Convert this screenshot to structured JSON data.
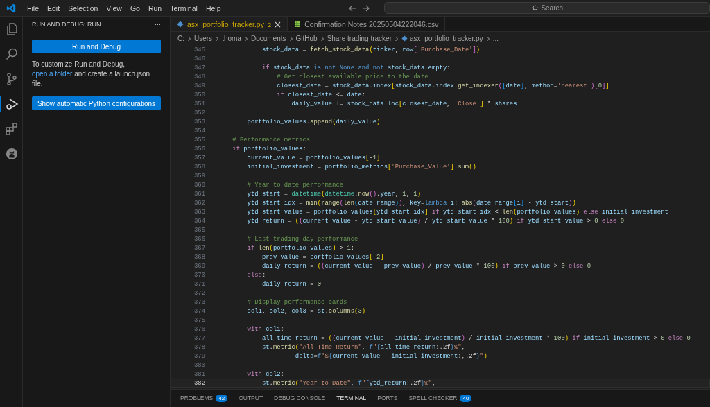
{
  "menu": [
    "File",
    "Edit",
    "Selection",
    "View",
    "Go",
    "Run",
    "Terminal",
    "Help"
  ],
  "search": {
    "placeholder": "Search"
  },
  "activity_bar": [
    {
      "kind": "files",
      "selected": false
    },
    {
      "kind": "search",
      "selected": false
    },
    {
      "kind": "source-control",
      "selected": false
    },
    {
      "kind": "run-debug",
      "selected": true
    },
    {
      "kind": "extensions",
      "selected": false
    },
    {
      "kind": "github",
      "selected": false
    }
  ],
  "sidebar": {
    "title": "RUN AND DEBUG: RUN",
    "more": "···",
    "run_button": "Run and Debug",
    "text_before": "To customize Run and Debug, ",
    "link": "open a folder",
    "text_after": " and create a launch.json file.",
    "python_button": "Show automatic Python configurations"
  },
  "tabs": [
    {
      "label": "asx_portfolio_tracker.py",
      "kind": "python",
      "badge": "2",
      "selected": true
    },
    {
      "label": "Confirmation Notes 20250504222046.csv",
      "kind": "csv",
      "selected": false
    }
  ],
  "breadcrumb": [
    "C:",
    "Users",
    "thoma",
    "Documents",
    "GitHub",
    "Share trading tracker",
    "asx_portfolio_tracker.py",
    "..."
  ],
  "code": [
    {
      "number": "345",
      "highlighted": false,
      "tokens": [
        {
          "kind": "var",
          "text": "            stock_data"
        },
        {
          "kind": "plain",
          "text": " = "
        },
        {
          "kind": "func",
          "text": "fetch_stock_data"
        },
        {
          "kind": "br1",
          "text": "("
        },
        {
          "kind": "var",
          "text": "ticker"
        },
        {
          "kind": "plain",
          "text": ", "
        },
        {
          "kind": "var",
          "text": "row"
        },
        {
          "kind": "br2",
          "text": "["
        },
        {
          "kind": "str",
          "text": "'Purchase_Date'"
        },
        {
          "kind": "br2",
          "text": "]"
        },
        {
          "kind": "br1",
          "text": ")"
        }
      ]
    },
    {
      "number": "346",
      "highlighted": false
    },
    {
      "number": "347",
      "highlighted": false,
      "tokens": [
        {
          "kind": "kw",
          "text": "            if "
        },
        {
          "kind": "var",
          "text": "stock_data "
        },
        {
          "kind": "ctl",
          "text": "is not None and not "
        },
        {
          "kind": "var",
          "text": "stock_data"
        },
        {
          "kind": "plain",
          "text": "."
        },
        {
          "kind": "var",
          "text": "empty"
        },
        {
          "kind": "plain",
          "text": ":"
        }
      ]
    },
    {
      "number": "348",
      "highlighted": false,
      "tokens": [
        {
          "kind": "com",
          "text": "                # Get closest available price to the date"
        }
      ]
    },
    {
      "number": "349",
      "highlighted": false,
      "tokens": [
        {
          "kind": "var",
          "text": "                closest_date"
        },
        {
          "kind": "plain",
          "text": " = "
        },
        {
          "kind": "var",
          "text": "stock_data"
        },
        {
          "kind": "plain",
          "text": "."
        },
        {
          "kind": "var",
          "text": "index"
        },
        {
          "kind": "br1",
          "text": "["
        },
        {
          "kind": "var",
          "text": "stock_data"
        },
        {
          "kind": "plain",
          "text": "."
        },
        {
          "kind": "var",
          "text": "index"
        },
        {
          "kind": "plain",
          "text": "."
        },
        {
          "kind": "func",
          "text": "get_indexer"
        },
        {
          "kind": "br2",
          "text": "("
        },
        {
          "kind": "br3",
          "text": "["
        },
        {
          "kind": "var",
          "text": "date"
        },
        {
          "kind": "br3",
          "text": "]"
        },
        {
          "kind": "plain",
          "text": ", "
        },
        {
          "kind": "var",
          "text": "method"
        },
        {
          "kind": "plain",
          "text": "="
        },
        {
          "kind": "str",
          "text": "'nearest'"
        },
        {
          "kind": "br2",
          "text": ")["
        },
        {
          "kind": "num",
          "text": "0"
        },
        {
          "kind": "br2",
          "text": "]"
        },
        {
          "kind": "br1",
          "text": "]"
        }
      ]
    },
    {
      "number": "350",
      "highlighted": false,
      "tokens": [
        {
          "kind": "kw",
          "text": "                if "
        },
        {
          "kind": "var",
          "text": "closest_date"
        },
        {
          "kind": "plain",
          "text": " <= "
        },
        {
          "kind": "var",
          "text": "date"
        },
        {
          "kind": "plain",
          "text": ":"
        }
      ]
    },
    {
      "number": "351",
      "highlighted": false,
      "tokens": [
        {
          "kind": "var",
          "text": "                    daily_value"
        },
        {
          "kind": "plain",
          "text": " += "
        },
        {
          "kind": "var",
          "text": "stock_data"
        },
        {
          "kind": "plain",
          "text": "."
        },
        {
          "kind": "var",
          "text": "loc"
        },
        {
          "kind": "br1",
          "text": "["
        },
        {
          "kind": "var",
          "text": "closest_date"
        },
        {
          "kind": "plain",
          "text": ", "
        },
        {
          "kind": "str",
          "text": "'Close'"
        },
        {
          "kind": "br1",
          "text": "]"
        },
        {
          "kind": "plain",
          "text": " * "
        },
        {
          "kind": "var",
          "text": "shares"
        }
      ]
    },
    {
      "number": "352",
      "highlighted": false
    },
    {
      "number": "353",
      "highlighted": false,
      "tokens": [
        {
          "kind": "var",
          "text": "        portfolio_values"
        },
        {
          "kind": "plain",
          "text": "."
        },
        {
          "kind": "func",
          "text": "append"
        },
        {
          "kind": "br1",
          "text": "("
        },
        {
          "kind": "var",
          "text": "daily_value"
        },
        {
          "kind": "br1",
          "text": ")"
        }
      ]
    },
    {
      "number": "354",
      "highlighted": false
    },
    {
      "number": "355",
      "highlighted": false,
      "tokens": [
        {
          "kind": "com",
          "text": "    # Performance metrics"
        }
      ]
    },
    {
      "number": "356",
      "highlighted": false,
      "tokens": [
        {
          "kind": "kw",
          "text": "    if "
        },
        {
          "kind": "var",
          "text": "portfolio_values"
        },
        {
          "kind": "plain",
          "text": ":"
        }
      ]
    },
    {
      "number": "357",
      "highlighted": false,
      "tokens": [
        {
          "kind": "var",
          "text": "        current_value"
        },
        {
          "kind": "plain",
          "text": " = "
        },
        {
          "kind": "var",
          "text": "portfolio_values"
        },
        {
          "kind": "br1",
          "text": "["
        },
        {
          "kind": "plain",
          "text": "-"
        },
        {
          "kind": "num",
          "text": "1"
        },
        {
          "kind": "br1",
          "text": "]"
        }
      ]
    },
    {
      "number": "358",
      "highlighted": false,
      "tokens": [
        {
          "kind": "var",
          "text": "        initial_investment"
        },
        {
          "kind": "plain",
          "text": " = "
        },
        {
          "kind": "var",
          "text": "portfolio_metrics"
        },
        {
          "kind": "br1",
          "text": "["
        },
        {
          "kind": "str",
          "text": "'Purchase_Value'"
        },
        {
          "kind": "br1",
          "text": "]"
        },
        {
          "kind": "plain",
          "text": "."
        },
        {
          "kind": "func",
          "text": "sum"
        },
        {
          "kind": "br1",
          "text": "()"
        }
      ]
    },
    {
      "number": "359",
      "highlighted": false
    },
    {
      "number": "360",
      "highlighted": false,
      "tokens": [
        {
          "kind": "com",
          "text": "        # Year to date performance"
        }
      ]
    },
    {
      "number": "361",
      "highlighted": false,
      "tokens": [
        {
          "kind": "var",
          "text": "        ytd_start"
        },
        {
          "kind": "plain",
          "text": " = "
        },
        {
          "kind": "type",
          "text": "datetime"
        },
        {
          "kind": "br1",
          "text": "("
        },
        {
          "kind": "type",
          "text": "datetime"
        },
        {
          "kind": "plain",
          "text": "."
        },
        {
          "kind": "func",
          "text": "now"
        },
        {
          "kind": "br2",
          "text": "()"
        },
        {
          "kind": "plain",
          "text": "."
        },
        {
          "kind": "var",
          "text": "year"
        },
        {
          "kind": "plain",
          "text": ", "
        },
        {
          "kind": "num",
          "text": "1"
        },
        {
          "kind": "plain",
          "text": ", "
        },
        {
          "kind": "num",
          "text": "1"
        },
        {
          "kind": "br1",
          "text": ")"
        }
      ]
    },
    {
      "number": "362",
      "highlighted": false,
      "tokens": [
        {
          "kind": "var",
          "text": "        ytd_start_idx"
        },
        {
          "kind": "plain",
          "text": " = "
        },
        {
          "kind": "func",
          "text": "min"
        },
        {
          "kind": "br1",
          "text": "("
        },
        {
          "kind": "func",
          "text": "range"
        },
        {
          "kind": "br2",
          "text": "("
        },
        {
          "kind": "func",
          "text": "len"
        },
        {
          "kind": "br3",
          "text": "("
        },
        {
          "kind": "var",
          "text": "date_range"
        },
        {
          "kind": "br3",
          "text": ")"
        },
        {
          "kind": "br2",
          "text": ")"
        },
        {
          "kind": "plain",
          "text": ", "
        },
        {
          "kind": "var",
          "text": "key"
        },
        {
          "kind": "plain",
          "text": "="
        },
        {
          "kind": "ctl",
          "text": "lambda "
        },
        {
          "kind": "var",
          "text": "i"
        },
        {
          "kind": "plain",
          "text": ": "
        },
        {
          "kind": "func",
          "text": "abs"
        },
        {
          "kind": "br2",
          "text": "("
        },
        {
          "kind": "var",
          "text": "date_range"
        },
        {
          "kind": "br3",
          "text": "["
        },
        {
          "kind": "var",
          "text": "i"
        },
        {
          "kind": "br3",
          "text": "]"
        },
        {
          "kind": "plain",
          "text": " - "
        },
        {
          "kind": "var",
          "text": "ytd_start"
        },
        {
          "kind": "br2",
          "text": ")"
        },
        {
          "kind": "br1",
          "text": ")"
        }
      ]
    },
    {
      "number": "363",
      "highlighted": false,
      "tokens": [
        {
          "kind": "var",
          "text": "        ytd_start_value"
        },
        {
          "kind": "plain",
          "text": " = "
        },
        {
          "kind": "var",
          "text": "portfolio_values"
        },
        {
          "kind": "br1",
          "text": "["
        },
        {
          "kind": "var",
          "text": "ytd_start_idx"
        },
        {
          "kind": "br1",
          "text": "]"
        },
        {
          "kind": "kw",
          "text": " if "
        },
        {
          "kind": "var",
          "text": "ytd_start_idx"
        },
        {
          "kind": "plain",
          "text": " < "
        },
        {
          "kind": "func",
          "text": "len"
        },
        {
          "kind": "br1",
          "text": "("
        },
        {
          "kind": "var",
          "text": "portfolio_values"
        },
        {
          "kind": "br1",
          "text": ")"
        },
        {
          "kind": "kw",
          "text": " else "
        },
        {
          "kind": "var",
          "text": "initial_investment"
        }
      ]
    },
    {
      "number": "364",
      "highlighted": false,
      "tokens": [
        {
          "kind": "var",
          "text": "        ytd_return"
        },
        {
          "kind": "plain",
          "text": " = "
        },
        {
          "kind": "br1",
          "text": "("
        },
        {
          "kind": "br2",
          "text": "("
        },
        {
          "kind": "var",
          "text": "current_value"
        },
        {
          "kind": "plain",
          "text": " - "
        },
        {
          "kind": "var",
          "text": "ytd_start_value"
        },
        {
          "kind": "br2",
          "text": ")"
        },
        {
          "kind": "plain",
          "text": " / "
        },
        {
          "kind": "var",
          "text": "ytd_start_value"
        },
        {
          "kind": "plain",
          "text": " * "
        },
        {
          "kind": "num",
          "text": "100"
        },
        {
          "kind": "br1",
          "text": ")"
        },
        {
          "kind": "kw",
          "text": " if "
        },
        {
          "kind": "var",
          "text": "ytd_start_value"
        },
        {
          "kind": "plain",
          "text": " > "
        },
        {
          "kind": "num",
          "text": "0"
        },
        {
          "kind": "kw",
          "text": " else "
        },
        {
          "kind": "num",
          "text": "0"
        }
      ]
    },
    {
      "number": "365",
      "highlighted": false
    },
    {
      "number": "366",
      "highlighted": false,
      "tokens": [
        {
          "kind": "com",
          "text": "        # Last trading day performance"
        }
      ]
    },
    {
      "number": "367",
      "highlighted": false,
      "tokens": [
        {
          "kind": "kw",
          "text": "        if "
        },
        {
          "kind": "func",
          "text": "len"
        },
        {
          "kind": "br1",
          "text": "("
        },
        {
          "kind": "var",
          "text": "portfolio_values"
        },
        {
          "kind": "br1",
          "text": ")"
        },
        {
          "kind": "plain",
          "text": " > "
        },
        {
          "kind": "num",
          "text": "1"
        },
        {
          "kind": "plain",
          "text": ":"
        }
      ]
    },
    {
      "number": "368",
      "highlighted": false,
      "tokens": [
        {
          "kind": "var",
          "text": "            prev_value"
        },
        {
          "kind": "plain",
          "text": " = "
        },
        {
          "kind": "var",
          "text": "portfolio_values"
        },
        {
          "kind": "br1",
          "text": "["
        },
        {
          "kind": "plain",
          "text": "-"
        },
        {
          "kind": "num",
          "text": "2"
        },
        {
          "kind": "br1",
          "text": "]"
        }
      ]
    },
    {
      "number": "369",
      "highlighted": false,
      "tokens": [
        {
          "kind": "var",
          "text": "            daily_return"
        },
        {
          "kind": "plain",
          "text": " = "
        },
        {
          "kind": "br1",
          "text": "("
        },
        {
          "kind": "br2",
          "text": "("
        },
        {
          "kind": "var",
          "text": "current_value"
        },
        {
          "kind": "plain",
          "text": " - "
        },
        {
          "kind": "var",
          "text": "prev_value"
        },
        {
          "kind": "br2",
          "text": ")"
        },
        {
          "kind": "plain",
          "text": " / "
        },
        {
          "kind": "var",
          "text": "prev_value"
        },
        {
          "kind": "plain",
          "text": " * "
        },
        {
          "kind": "num",
          "text": "100"
        },
        {
          "kind": "br1",
          "text": ")"
        },
        {
          "kind": "kw",
          "text": " if "
        },
        {
          "kind": "var",
          "text": "prev_value"
        },
        {
          "kind": "plain",
          "text": " > "
        },
        {
          "kind": "num",
          "text": "0"
        },
        {
          "kind": "kw",
          "text": " else "
        },
        {
          "kind": "num",
          "text": "0"
        }
      ]
    },
    {
      "number": "370",
      "highlighted": false,
      "tokens": [
        {
          "kind": "kw",
          "text": "        else"
        },
        {
          "kind": "plain",
          "text": ":"
        }
      ]
    },
    {
      "number": "371",
      "highlighted": false,
      "tokens": [
        {
          "kind": "var",
          "text": "            daily_return"
        },
        {
          "kind": "plain",
          "text": " = "
        },
        {
          "kind": "num",
          "text": "0"
        }
      ]
    },
    {
      "number": "372",
      "highlighted": false
    },
    {
      "number": "373",
      "highlighted": false,
      "tokens": [
        {
          "kind": "com",
          "text": "        # Display performance cards"
        }
      ]
    },
    {
      "number": "374",
      "highlighted": false,
      "tokens": [
        {
          "kind": "var",
          "text": "        col1"
        },
        {
          "kind": "plain",
          "text": ", "
        },
        {
          "kind": "var",
          "text": "col2"
        },
        {
          "kind": "plain",
          "text": ", "
        },
        {
          "kind": "var",
          "text": "col3"
        },
        {
          "kind": "plain",
          "text": " = "
        },
        {
          "kind": "var",
          "text": "st"
        },
        {
          "kind": "plain",
          "text": "."
        },
        {
          "kind": "func",
          "text": "columns"
        },
        {
          "kind": "br1",
          "text": "("
        },
        {
          "kind": "num",
          "text": "3"
        },
        {
          "kind": "br1",
          "text": ")"
        }
      ]
    },
    {
      "number": "375",
      "highlighted": false
    },
    {
      "number": "376",
      "highlighted": false,
      "tokens": [
        {
          "kind": "kw",
          "text": "        with "
        },
        {
          "kind": "var",
          "text": "col1"
        },
        {
          "kind": "plain",
          "text": ":"
        }
      ]
    },
    {
      "number": "377",
      "highlighted": false,
      "tokens": [
        {
          "kind": "var",
          "text": "            all_time_return"
        },
        {
          "kind": "plain",
          "text": " = "
        },
        {
          "kind": "br1",
          "text": "("
        },
        {
          "kind": "br2",
          "text": "("
        },
        {
          "kind": "var",
          "text": "current_value"
        },
        {
          "kind": "plain",
          "text": " - "
        },
        {
          "kind": "var",
          "text": "initial_investment"
        },
        {
          "kind": "br2",
          "text": ")"
        },
        {
          "kind": "plain",
          "text": " / "
        },
        {
          "kind": "var",
          "text": "initial_investment"
        },
        {
          "kind": "plain",
          "text": " * "
        },
        {
          "kind": "num",
          "text": "100"
        },
        {
          "kind": "br1",
          "text": ")"
        },
        {
          "kind": "kw",
          "text": " if "
        },
        {
          "kind": "var",
          "text": "initial_investment"
        },
        {
          "kind": "plain",
          "text": " > "
        },
        {
          "kind": "num",
          "text": "0"
        },
        {
          "kind": "kw",
          "text": " else "
        },
        {
          "kind": "num",
          "text": "0"
        }
      ]
    },
    {
      "number": "378",
      "highlighted": false,
      "tokens": [
        {
          "kind": "var",
          "text": "            st"
        },
        {
          "kind": "plain",
          "text": "."
        },
        {
          "kind": "func",
          "text": "metric"
        },
        {
          "kind": "br1",
          "text": "("
        },
        {
          "kind": "str",
          "text": "\"All Time Return\""
        },
        {
          "kind": "plain",
          "text": ", "
        },
        {
          "kind": "ctl",
          "text": "f"
        },
        {
          "kind": "str",
          "text": "\""
        },
        {
          "kind": "ctl",
          "text": "{"
        },
        {
          "kind": "var",
          "text": "all_time_return"
        },
        {
          "kind": "plain",
          "text": ":.2f"
        },
        {
          "kind": "ctl",
          "text": "}"
        },
        {
          "kind": "str",
          "text": "%\""
        },
        {
          "kind": "plain",
          "text": ","
        }
      ]
    },
    {
      "number": "379",
      "highlighted": false,
      "tokens": [
        {
          "kind": "var",
          "text": "                     delta"
        },
        {
          "kind": "plain",
          "text": "="
        },
        {
          "kind": "ctl",
          "text": "f"
        },
        {
          "kind": "str",
          "text": "\"$"
        },
        {
          "kind": "ctl",
          "text": "{"
        },
        {
          "kind": "var",
          "text": "current_value"
        },
        {
          "kind": "plain",
          "text": " - "
        },
        {
          "kind": "var",
          "text": "initial_investment"
        },
        {
          "kind": "plain",
          "text": ":,.2f"
        },
        {
          "kind": "ctl",
          "text": "}"
        },
        {
          "kind": "str",
          "text": "\""
        },
        {
          "kind": "br1",
          "text": ")"
        }
      ]
    },
    {
      "number": "380",
      "highlighted": false
    },
    {
      "number": "381",
      "highlighted": false,
      "tokens": [
        {
          "kind": "kw",
          "text": "        with "
        },
        {
          "kind": "var",
          "text": "col2"
        },
        {
          "kind": "plain",
          "text": ":"
        }
      ]
    },
    {
      "number": "382",
      "highlighted": true,
      "tokens": [
        {
          "kind": "var",
          "text": "            st"
        },
        {
          "kind": "plain",
          "text": "."
        },
        {
          "kind": "func",
          "text": "metric"
        },
        {
          "kind": "br1",
          "text": "("
        },
        {
          "kind": "str",
          "text": "\"Year to Date\""
        },
        {
          "kind": "plain",
          "text": ", "
        },
        {
          "kind": "ctl",
          "text": "f"
        },
        {
          "kind": "str",
          "text": "\""
        },
        {
          "kind": "ctl",
          "text": "{"
        },
        {
          "kind": "var",
          "text": "ytd_return"
        },
        {
          "kind": "plain",
          "text": ":.2f"
        },
        {
          "kind": "ctl",
          "text": "}"
        },
        {
          "kind": "str",
          "text": "%\""
        },
        {
          "kind": "plain",
          "text": ","
        }
      ]
    }
  ],
  "panel_tabs": [
    {
      "label": "PROBLEMS",
      "badge": "42",
      "selected": false
    },
    {
      "label": "OUTPUT",
      "selected": false
    },
    {
      "label": "DEBUG CONSOLE",
      "selected": false
    },
    {
      "label": "TERMINAL",
      "selected": true
    },
    {
      "label": "PORTS",
      "selected": false
    },
    {
      "label": "SPELL CHECKER",
      "badge": "40",
      "selected": false
    }
  ]
}
